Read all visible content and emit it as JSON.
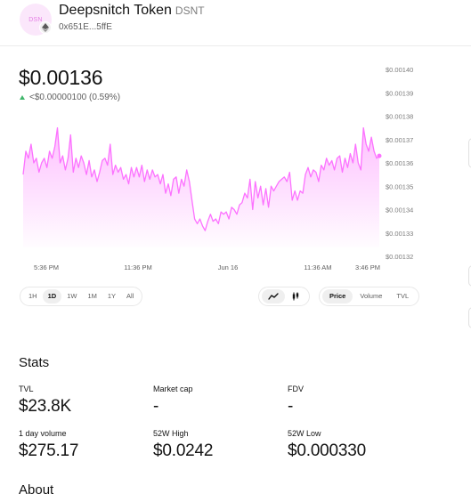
{
  "token": {
    "logo_text": "DSN",
    "name": "Deepsnitch Token",
    "symbol": "DSNT",
    "address": "0x651E...5ffE",
    "network_icon": "ethereum-icon"
  },
  "price": {
    "value": "$0.00136",
    "change": "<$0.00000100 (0.59%)",
    "change_direction_icon": "triangle-up-icon",
    "change_color": "#40b66b"
  },
  "chart_data": {
    "type": "area",
    "accent_color": "#fc72ff",
    "x_tick_labels": [
      "5:36 PM",
      "11:36 PM",
      "Jun 16",
      "11:36 AM",
      "3:46 PM"
    ],
    "y_tick_labels": [
      "$0.00140",
      "$0.00139",
      "$0.00138",
      "$0.00137",
      "$0.00136",
      "$0.00135",
      "$0.00134",
      "$0.00133",
      "$0.00132"
    ],
    "ylim": [
      0.00132,
      0.0014
    ],
    "grid": false,
    "values": [
      0.001355,
      0.001365,
      0.001362,
      0.001368,
      0.00136,
      0.001362,
      0.001356,
      0.00136,
      0.001362,
      0.001358,
      0.001365,
      0.001362,
      0.001367,
      0.001375,
      0.00136,
      0.001363,
      0.001357,
      0.001362,
      0.001372,
      0.001356,
      0.001362,
      0.001358,
      0.001363,
      0.00136,
      0.001355,
      0.001361,
      0.001354,
      0.001357,
      0.001352,
      0.001356,
      0.001361,
      0.001362,
      0.001359,
      0.001368,
      0.001355,
      0.001359,
      0.001356,
      0.001358,
      0.001353,
      0.001355,
      0.001351,
      0.001358,
      0.001354,
      0.001358,
      0.001354,
      0.001359,
      0.001352,
      0.001357,
      0.001353,
      0.001357,
      0.001354,
      0.001355,
      0.001351,
      0.001355,
      0.001347,
      0.001351,
      0.001346,
      0.001353,
      0.001354,
      0.001347,
      0.001353,
      0.00135,
      0.001357,
      0.001352,
      0.001344,
      0.001336,
      0.001334,
      0.001336,
      0.001333,
      0.001331,
      0.001335,
      0.001338,
      0.001335,
      0.001336,
      0.001334,
      0.001339,
      0.001338,
      0.001339,
      0.001336,
      0.001341,
      0.00134,
      0.001338,
      0.001342,
      0.001343,
      0.001347,
      0.001345,
      0.001353,
      0.00134,
      0.001352,
      0.001345,
      0.00135,
      0.001342,
      0.001349,
      0.001341,
      0.00135,
      0.001348,
      0.00135,
      0.001352,
      0.001353,
      0.001354,
      0.001352,
      0.001356,
      0.001344,
      0.001348,
      0.001344,
      0.001348,
      0.001347,
      0.001355,
      0.001358,
      0.001354,
      0.001357,
      0.001356,
      0.001352,
      0.001359,
      0.001357,
      0.001362,
      0.001359,
      0.001361,
      0.001357,
      0.001362,
      0.001363,
      0.001356,
      0.001362,
      0.001358,
      0.001364,
      0.00136,
      0.001368,
      0.00136,
      0.001357,
      0.001375,
      0.001368,
      0.001365,
      0.001371,
      0.001365,
      0.001362,
      0.001363
    ],
    "current_value": 0.001363
  },
  "controls": {
    "time_ranges": [
      "1H",
      "1D",
      "1W",
      "1M",
      "1Y",
      "All"
    ],
    "selected_time_range": "1D",
    "chart_types": [
      "line-chart-icon",
      "candlestick-icon"
    ],
    "selected_chart_type": "line-chart-icon",
    "metrics": [
      "Price",
      "Volume",
      "TVL"
    ],
    "selected_metric": "Price"
  },
  "stats": {
    "title": "Stats",
    "items": [
      {
        "label": "TVL",
        "value": "$23.8K"
      },
      {
        "label": "Market cap",
        "value": "-"
      },
      {
        "label": "FDV",
        "value": "-"
      },
      {
        "label": "1 day volume",
        "value": "$275.17"
      },
      {
        "label": "52W High",
        "value": "$0.0242"
      },
      {
        "label": "52W Low",
        "value": "$0.000330"
      }
    ]
  },
  "about": {
    "title": "About"
  }
}
